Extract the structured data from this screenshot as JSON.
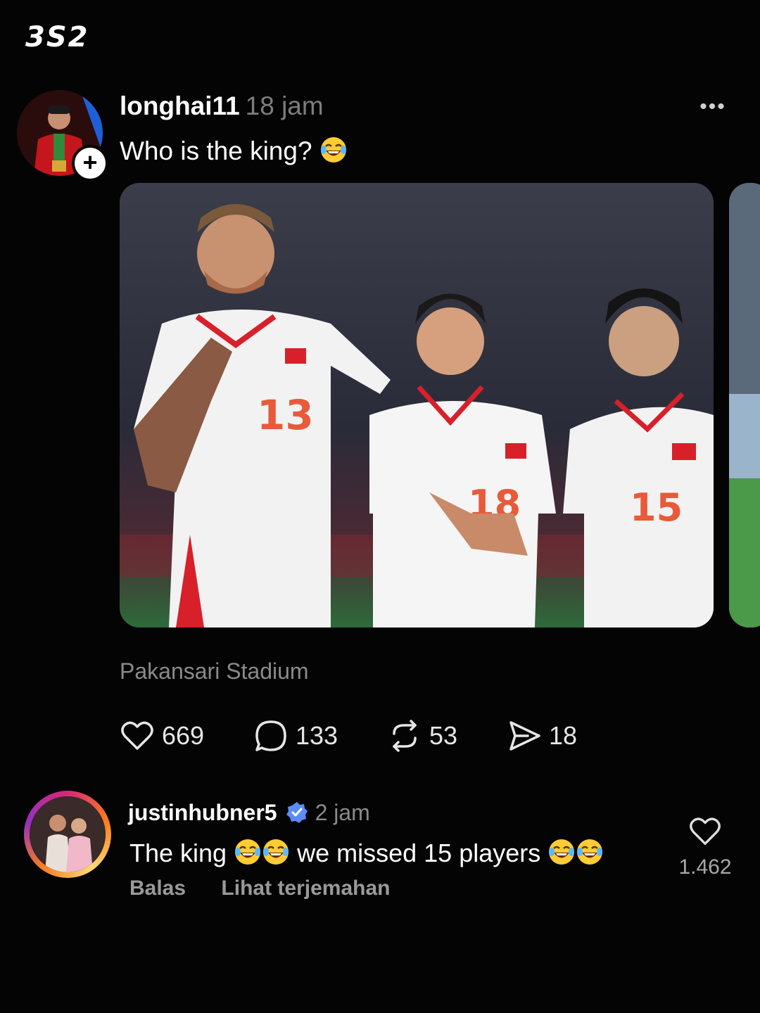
{
  "app": {
    "logo_text": "3S2"
  },
  "post": {
    "username": "longhai11",
    "time": "18 jam",
    "caption": "Who is the king?",
    "caption_emoji": "face-with-tears-of-joy",
    "follow_symbol": "+",
    "more_symbol": "•••",
    "location": "Pakansari Stadium",
    "media": {
      "description_icon": "photo",
      "jersey_numbers": [
        "13",
        "18",
        "15"
      ]
    },
    "actions": {
      "likes": "669",
      "comments": "133",
      "reposts": "53",
      "shares": "18"
    }
  },
  "comment": {
    "username": "justinhubner5",
    "verified": true,
    "time": "2 jam",
    "text_part1": "The king",
    "text_part2": "we missed 15 players",
    "reply_label": "Balas",
    "translate_label": "Lihat terjemahan",
    "like_count": "1.462"
  },
  "colors": {
    "background": "#040404",
    "verified": "#5b8cff",
    "muted": "#8a8a8a",
    "story_ring": "#d62976"
  }
}
